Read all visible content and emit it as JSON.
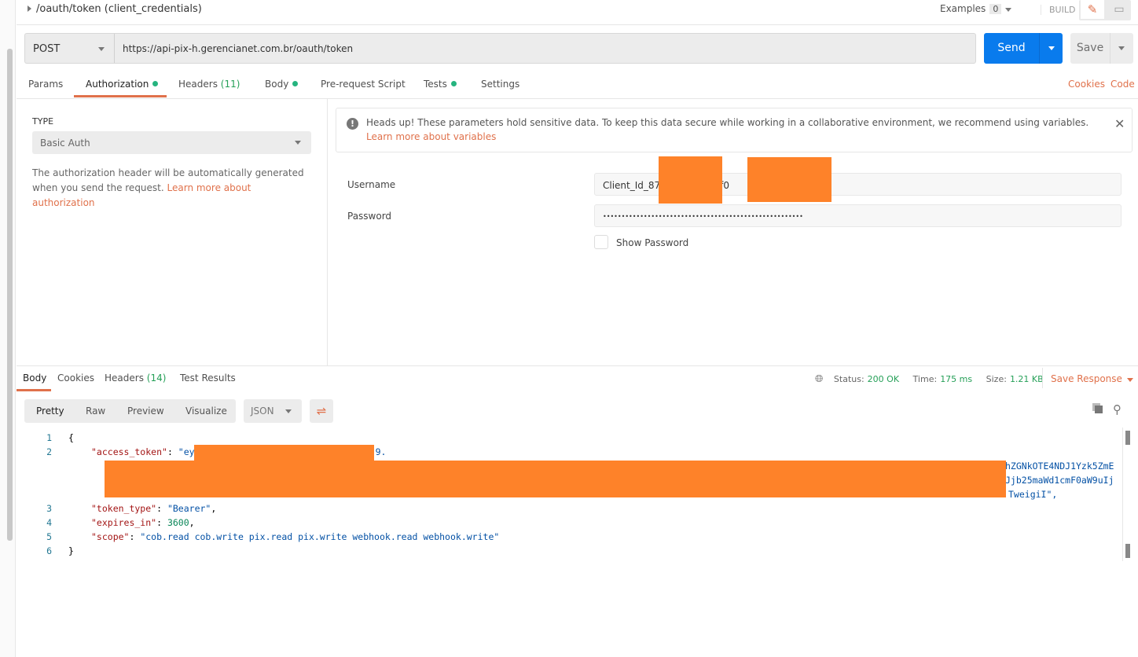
{
  "request": {
    "name": "/oauth/token (client_credentials)",
    "examples_label": "Examples",
    "examples_count": "0",
    "build_label": "BUILD",
    "method": "POST",
    "url": "https://api-pix-h.gerencianet.com.br/oauth/token",
    "send_label": "Send",
    "save_label": "Save"
  },
  "request_tabs": {
    "params": "Params",
    "authorization": "Authorization",
    "headers": "Headers",
    "headers_count": "(11)",
    "body": "Body",
    "prerequest": "Pre-request Script",
    "tests": "Tests",
    "settings": "Settings",
    "cookies": "Cookies",
    "code": "Code"
  },
  "auth": {
    "type_label": "TYPE",
    "type_value": "Basic Auth",
    "description": "The authorization header will be automatically generated when you send the request. ",
    "description_link": "Learn more about authorization",
    "alert_text": "Heads up! These parameters hold sensitive data. To keep this data secure while working in a collaborative environment, we recommend using variables. ",
    "alert_link": "Learn more about variables",
    "username_label": "Username",
    "username_value": "Client_Id_874            0abf0                  e41f",
    "password_label": "Password",
    "password_value": "••••••••••••••••••••••••••••••••••••••••••••••••••••••",
    "show_password_label": "Show Password"
  },
  "response": {
    "tabs": {
      "body": "Body",
      "cookies": "Cookies",
      "headers": "Headers",
      "headers_count": "(14)",
      "test_results": "Test Results"
    },
    "status_label": "Status:",
    "status_value": "200 OK",
    "time_label": "Time:",
    "time_value": "175 ms",
    "size_label": "Size:",
    "size_value": "1.21 KB",
    "save_response": "Save Response",
    "formats": {
      "pretty": "Pretty",
      "raw": "Raw",
      "preview": "Preview",
      "visualize": "Visualize"
    },
    "language": "JSON",
    "body": {
      "open": "{",
      "access_token_key": "\"access_token\"",
      "access_token_start": "\"ey",
      "access_token_mid": "9.",
      "access_token_wrap1": "hZGNkOTE4NDJ1Yzk5ZmE",
      "access_token_wrap2": "Jjb25maWd1cmF0aW9uIj",
      "access_token_end": "TweigiI\",",
      "token_type_key": "\"token_type\"",
      "token_type_value": "\"Bearer\"",
      "expires_in_key": "\"expires_in\"",
      "expires_in_value": "3600",
      "scope_key": "\"scope\"",
      "scope_value": "\"cob.read cob.write pix.read pix.write webhook.read webhook.write\"",
      "close": "}",
      "line_numbers": [
        "1",
        "2",
        "3",
        "4",
        "5",
        "6"
      ]
    }
  },
  "colors": {
    "accent": "#e0714b",
    "send": "#097bed",
    "success": "#26a058",
    "redaction": "#fe8229"
  }
}
